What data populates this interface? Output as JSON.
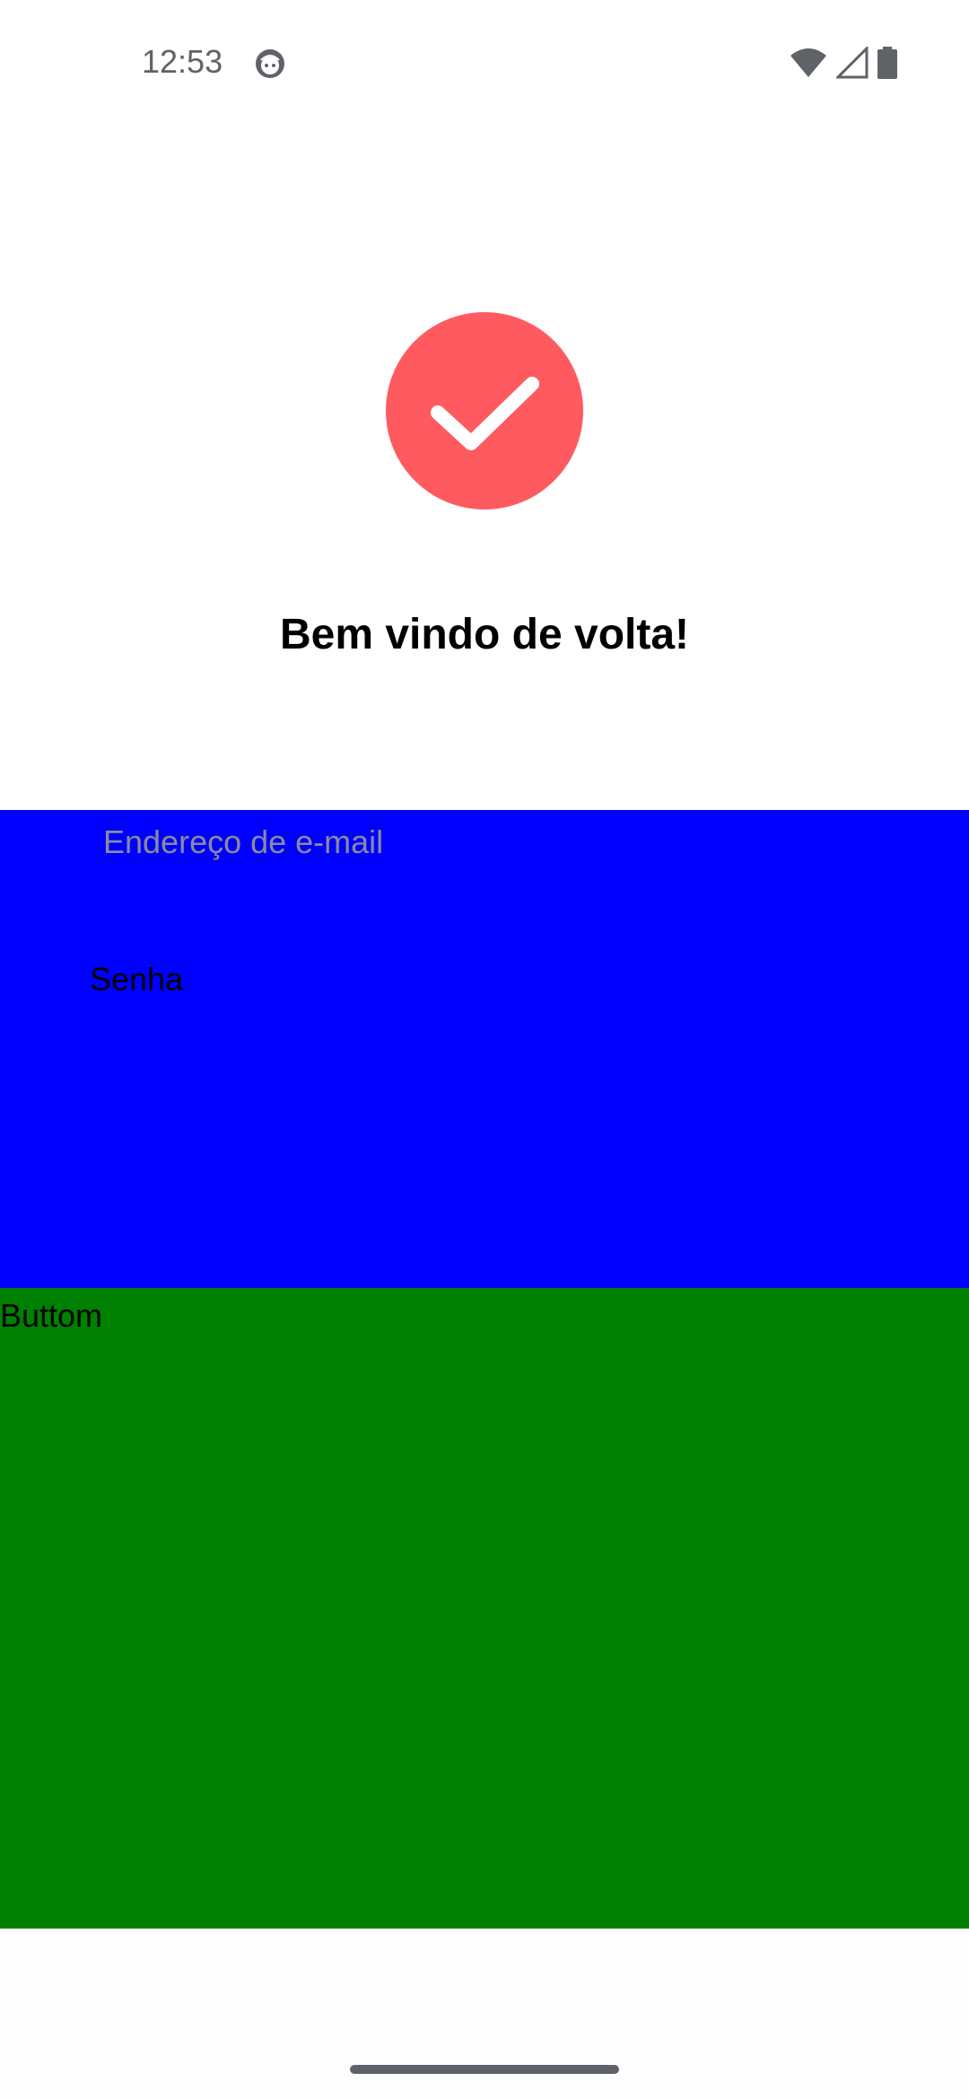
{
  "status_bar": {
    "time": "12:53",
    "notification_icon": "android-face-icon",
    "icons": [
      "wifi-icon",
      "signal-icon",
      "battery-icon"
    ]
  },
  "logo": {
    "icon": "checkmark-circle-icon",
    "color": "#ff5a5f"
  },
  "welcome": {
    "title": "Bem vindo de volta!"
  },
  "form": {
    "background_color": "#0000ff",
    "email_placeholder": "Endereço de e-mail",
    "email_value": "",
    "password_label": "Senha"
  },
  "bottom": {
    "background_color": "#008000",
    "label": "Buttom"
  },
  "nav": {
    "home_indicator": "gesture-bar"
  }
}
